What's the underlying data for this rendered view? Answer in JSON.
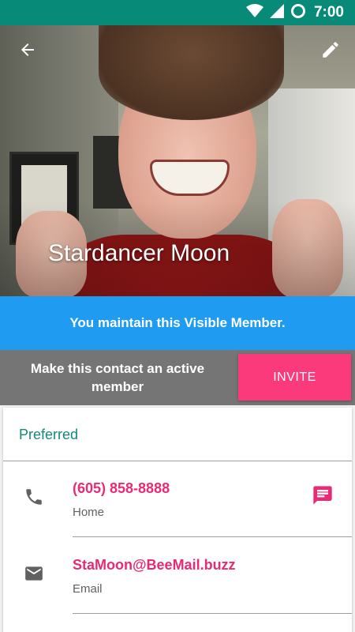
{
  "status_bar": {
    "time": "7:00",
    "icons": [
      "wifi-icon",
      "cell-signal-icon",
      "do-not-disturb-icon"
    ],
    "color": "#078a78"
  },
  "header": {
    "contact_name": "Stardancer Moon",
    "back_icon": "arrow-back-icon",
    "edit_icon": "pencil-icon"
  },
  "banner": {
    "text": "You maintain this Visible Member.",
    "color": "#1f9bf2"
  },
  "invite": {
    "message": "Make this contact an active member",
    "button_label": "INVITE",
    "button_color": "#fb3a7c"
  },
  "details": {
    "section_title": "Preferred",
    "items": [
      {
        "value": "(605) 858-8888",
        "label": "Home",
        "icon": "phone-icon",
        "action_icon": "message-icon"
      },
      {
        "value": "StaMoon@BeeMail.buzz",
        "label": "Email",
        "icon": "email-icon"
      }
    ]
  },
  "colors": {
    "accent_pink": "#e92a74",
    "section_green": "#158876"
  }
}
